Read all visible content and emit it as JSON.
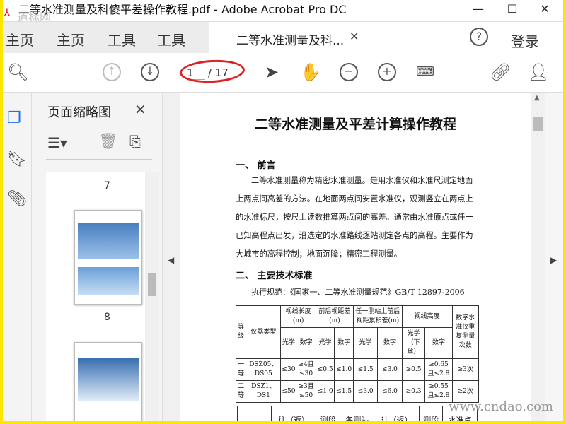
{
  "window": {
    "title": "二等水准测量及科傻平差操作教程.pdf - Adobe Acrobat Pro DC",
    "watermark": "道标网",
    "min": "—",
    "max": "☐",
    "close": "✕"
  },
  "menu": {
    "items": [
      "主页",
      "主页",
      "工具",
      "工具"
    ],
    "tab": "二等水准测量及科...",
    "tab_close": "✕",
    "help": "?",
    "login": "登录"
  },
  "toolbar": {
    "current_page": "1",
    "total_pages": "/ 17"
  },
  "panel": {
    "title": "页面缩略图",
    "close": "✕",
    "thumb_labels": [
      "7",
      "8"
    ]
  },
  "doc": {
    "title": "二等水准测量及平差计算操作教程",
    "s1": "一、 前言",
    "p1": "二等水准测量称为精密水准测量。是用水准仪和水准尺测定地面上两点间高差的方法。在地面两点间安置水准仪，观测竖立在两点上的水准标尺，按尺上读数推算两点间的高差。通常由水准原点或任一已知高程点出发，沿选定的水准路线逐站测定各点的高程。主要作为大城市的高程控制；地面沉降；精密工程测量。",
    "s2": "二、 主要技术标准",
    "p2": "执行规范：《国家一、二等水准测量规范》GB/T 12897-2006",
    "table": {
      "h1": [
        "等级",
        "仪器类型",
        "视线长度(m)",
        "前后视距差(m)",
        "任一测站上前后视距累积差(m)",
        "视线高度",
        "数字水准仪重复测量次数"
      ],
      "h2": [
        "光学",
        "数字",
        "光学",
        "数字",
        "光学",
        "数字",
        "光学（下丝）",
        "数字"
      ],
      "rows": [
        [
          "一等",
          "DSZ05、DS05",
          "≤30",
          "≥4且≤30",
          "≤0.5",
          "≤1.0",
          "≤1.5",
          "≤3.0",
          "≥0.5",
          "≥0.65且≤2.8",
          "≥3次"
        ],
        [
          "二等",
          "DSZ1、DS1",
          "≤50",
          "≥3且≤50",
          "≤1.0",
          "≤1.5",
          "≤3.0",
          "≤6.0",
          "≥0.3",
          "≥0.55且≤2.8",
          "≥2次"
        ]
      ]
    },
    "table2_headers": [
      "往（返）",
      "测段",
      "各测站",
      "往（返）",
      "测段",
      "水准点"
    ]
  },
  "site_watermark": "www.cndao.com"
}
